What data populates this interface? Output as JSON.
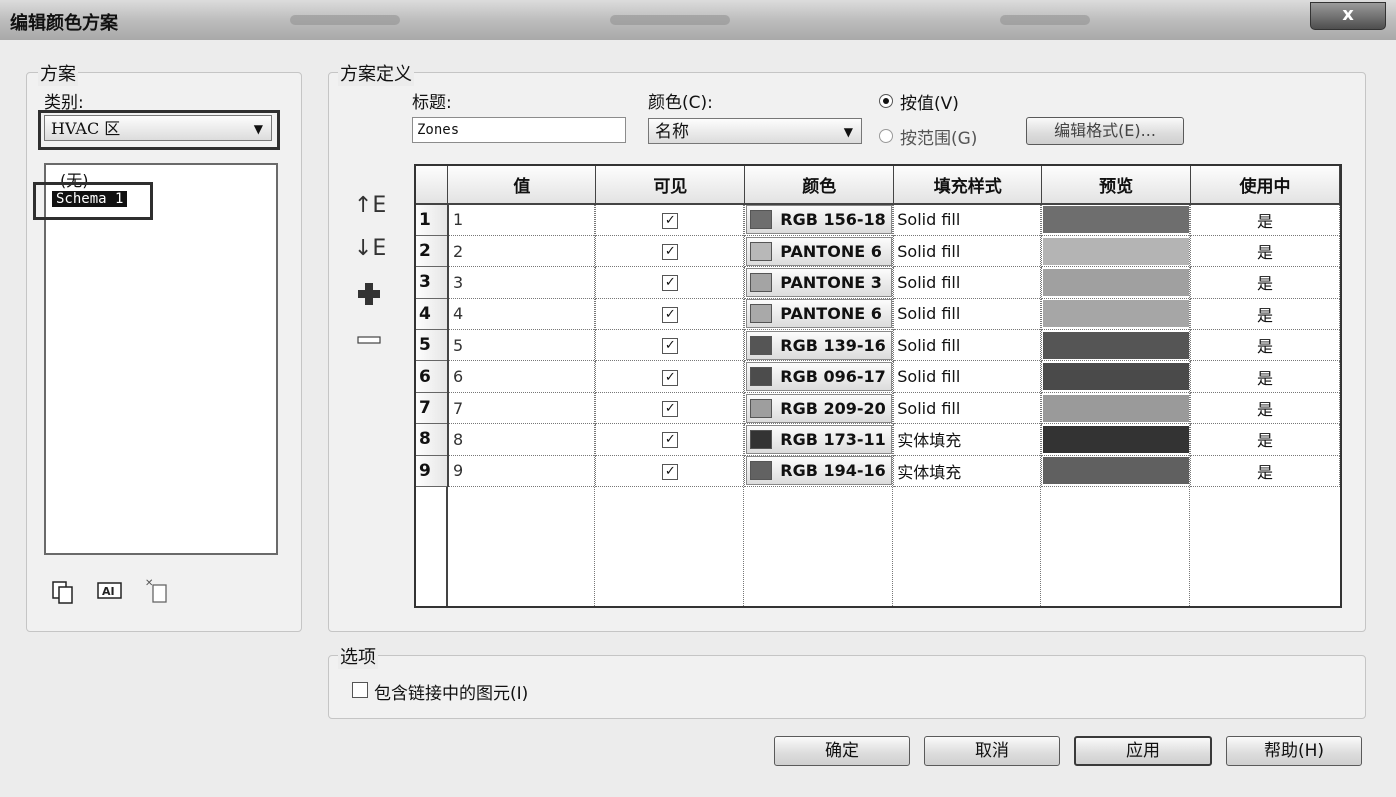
{
  "window": {
    "title": "编辑颜色方案",
    "close_label": "x"
  },
  "scheme_panel": {
    "legend": "方案",
    "category_label": "类别:",
    "category_value": "HVAC 区",
    "list_items": [
      "(无)",
      "Schema 1"
    ],
    "selected_item": "Schema 1"
  },
  "definition": {
    "legend": "方案定义",
    "title_label": "标题:",
    "title_value": "Zones",
    "color_label": "颜色(C):",
    "color_value": "名称",
    "by_value_label": "按值(V)",
    "by_range_label": "按范围(G)",
    "edit_format_label": "编辑格式(E)...",
    "by_value_selected": true
  },
  "table": {
    "columns": [
      "值",
      "可见",
      "颜色",
      "填充样式",
      "预览",
      "使用中"
    ],
    "rows": [
      {
        "num": "1",
        "value": "1",
        "visible": true,
        "color_name": "RGB 156-18",
        "swatch": "#6e6e6e",
        "fill": "Solid fill",
        "preview": "#6e6e6e",
        "in_use": "是"
      },
      {
        "num": "2",
        "value": "2",
        "visible": true,
        "color_name": "PANTONE 6",
        "swatch": "#b8b8b8",
        "fill": "Solid fill",
        "preview": "#b4b4b4",
        "in_use": "是"
      },
      {
        "num": "3",
        "value": "3",
        "visible": true,
        "color_name": "PANTONE 3",
        "swatch": "#a4a4a4",
        "fill": "Solid fill",
        "preview": "#a0a0a0",
        "in_use": "是"
      },
      {
        "num": "4",
        "value": "4",
        "visible": true,
        "color_name": "PANTONE 6",
        "swatch": "#a9a9a9",
        "fill": "Solid fill",
        "preview": "#a6a6a6",
        "in_use": "是"
      },
      {
        "num": "5",
        "value": "5",
        "visible": true,
        "color_name": "RGB 139-16",
        "swatch": "#555555",
        "fill": "Solid fill",
        "preview": "#555555",
        "in_use": "是"
      },
      {
        "num": "6",
        "value": "6",
        "visible": true,
        "color_name": "RGB 096-17",
        "swatch": "#4c4c4c",
        "fill": "Solid fill",
        "preview": "#4a4a4a",
        "in_use": "是"
      },
      {
        "num": "7",
        "value": "7",
        "visible": true,
        "color_name": "RGB 209-20",
        "swatch": "#9e9e9e",
        "fill": "Solid fill",
        "preview": "#9a9a9a",
        "in_use": "是"
      },
      {
        "num": "8",
        "value": "8",
        "visible": true,
        "color_name": "RGB 173-11",
        "swatch": "#333333",
        "fill": "实体填充",
        "preview": "#333333",
        "in_use": "是"
      },
      {
        "num": "9",
        "value": "9",
        "visible": true,
        "color_name": "RGB 194-16",
        "swatch": "#626262",
        "fill": "实体填充",
        "preview": "#606060",
        "in_use": "是"
      }
    ]
  },
  "options": {
    "legend": "选项",
    "include_linked_label": "包含链接中的图元(I)",
    "include_linked_checked": false
  },
  "footer": {
    "ok_label": "确定",
    "cancel_label": "取消",
    "apply_label": "应用",
    "help_label": "帮助(H)"
  },
  "icons": {
    "move_up": "move-up-icon",
    "move_down": "move-down-icon",
    "add": "plus-icon",
    "remove": "minus-icon",
    "duplicate": "duplicate-icon",
    "rename": "rename-icon",
    "delete": "delete-icon"
  }
}
